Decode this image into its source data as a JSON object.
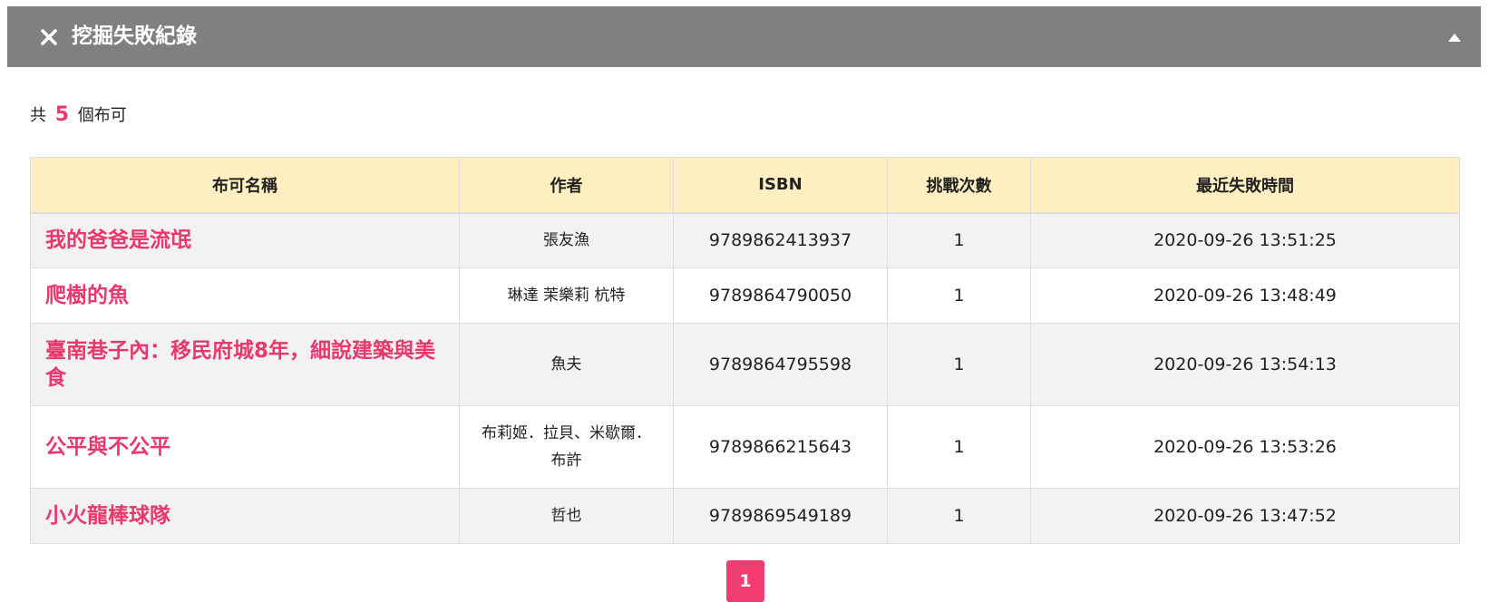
{
  "panel": {
    "title": "挖掘失敗紀錄"
  },
  "summary": {
    "prefix": "共",
    "count": "5",
    "suffix": "個布可"
  },
  "table": {
    "headers": [
      "布可名稱",
      "作者",
      "ISBN",
      "挑戰次數",
      "最近失敗時間"
    ],
    "rows": [
      {
        "title": "我的爸爸是流氓",
        "author": "張友漁",
        "isbn": "9789862413937",
        "attempts": "1",
        "last_failed": "2020-09-26 13:51:25"
      },
      {
        "title": "爬樹的魚",
        "author": "琳達 茉樂莉 杭特",
        "isbn": "9789864790050",
        "attempts": "1",
        "last_failed": "2020-09-26 13:48:49"
      },
      {
        "title": "臺南巷子內：移民府城8年，細說建築與美食",
        "author": "魚夫",
        "isbn": "9789864795598",
        "attempts": "1",
        "last_failed": "2020-09-26 13:54:13"
      },
      {
        "title": "公平與不公平",
        "author": "布莉姬．拉貝、米歇爾．布許",
        "isbn": "9789866215643",
        "attempts": "1",
        "last_failed": "2020-09-26 13:53:26"
      },
      {
        "title": "小火龍棒球隊",
        "author": "哲也",
        "isbn": "9789869549189",
        "attempts": "1",
        "last_failed": "2020-09-26 13:47:52"
      }
    ]
  },
  "pagination": {
    "current": "1"
  },
  "colors": {
    "header_bar": "#808080",
    "accent": "#e8386d",
    "table_header_bg": "#fff0c2",
    "stripe": "#f2f2f2"
  },
  "icons": {
    "close": "close-icon",
    "collapse": "caret-up-icon"
  }
}
